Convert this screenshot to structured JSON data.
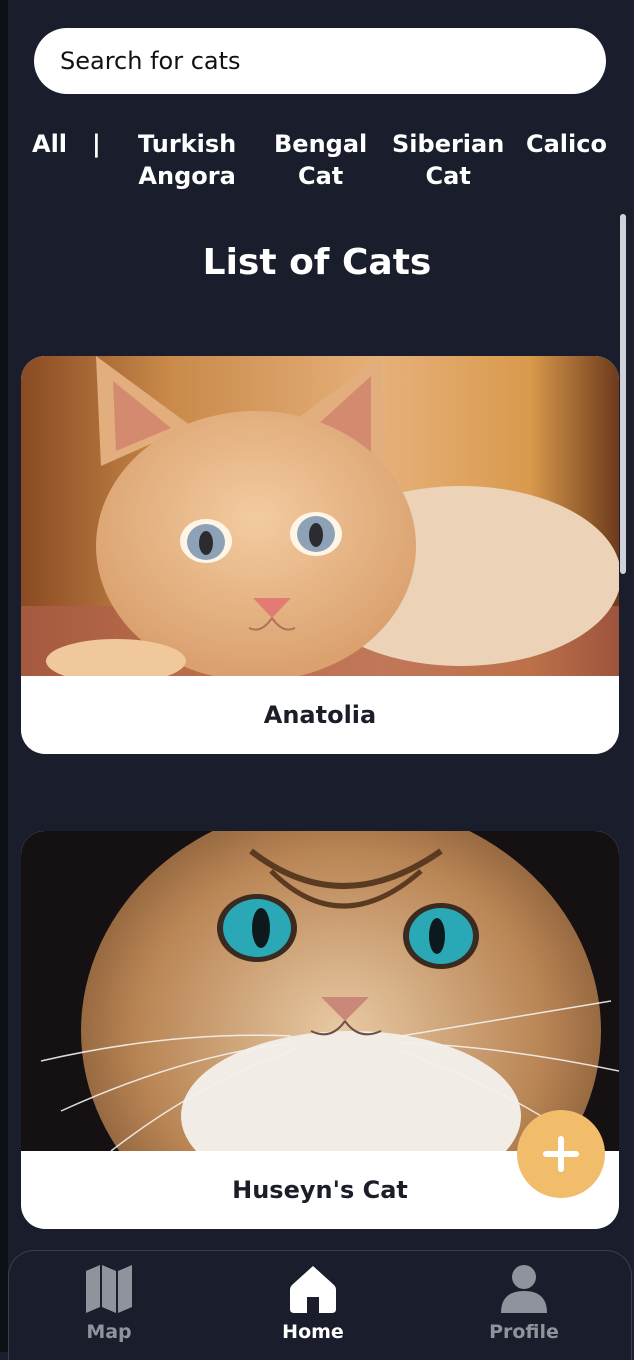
{
  "search": {
    "placeholder": "Search for cats",
    "value": ""
  },
  "filters": {
    "items": [
      {
        "label": "All"
      },
      {
        "label": "Turkish\nAngora"
      },
      {
        "label": "Bengal\nCat"
      },
      {
        "label": "Siberian\nCat"
      },
      {
        "label": "Calico"
      }
    ],
    "separator": "|"
  },
  "page": {
    "title": "List of Cats"
  },
  "cats": [
    {
      "name": "Anatolia",
      "image": "ginger-cat-photo"
    },
    {
      "name": "Huseyn's Cat",
      "image": "tabby-cat-photo"
    }
  ],
  "fab": {
    "icon": "plus-icon"
  },
  "nav": {
    "items": [
      {
        "label": "Map",
        "icon": "map-icon"
      },
      {
        "label": "Home",
        "icon": "home-icon"
      },
      {
        "label": "Profile",
        "icon": "person-icon"
      }
    ],
    "active": "Home"
  },
  "colors": {
    "background": "#1a1e2c",
    "accent": "#f2bd6b",
    "card": "#ffffff",
    "muted": "#8f939c"
  }
}
